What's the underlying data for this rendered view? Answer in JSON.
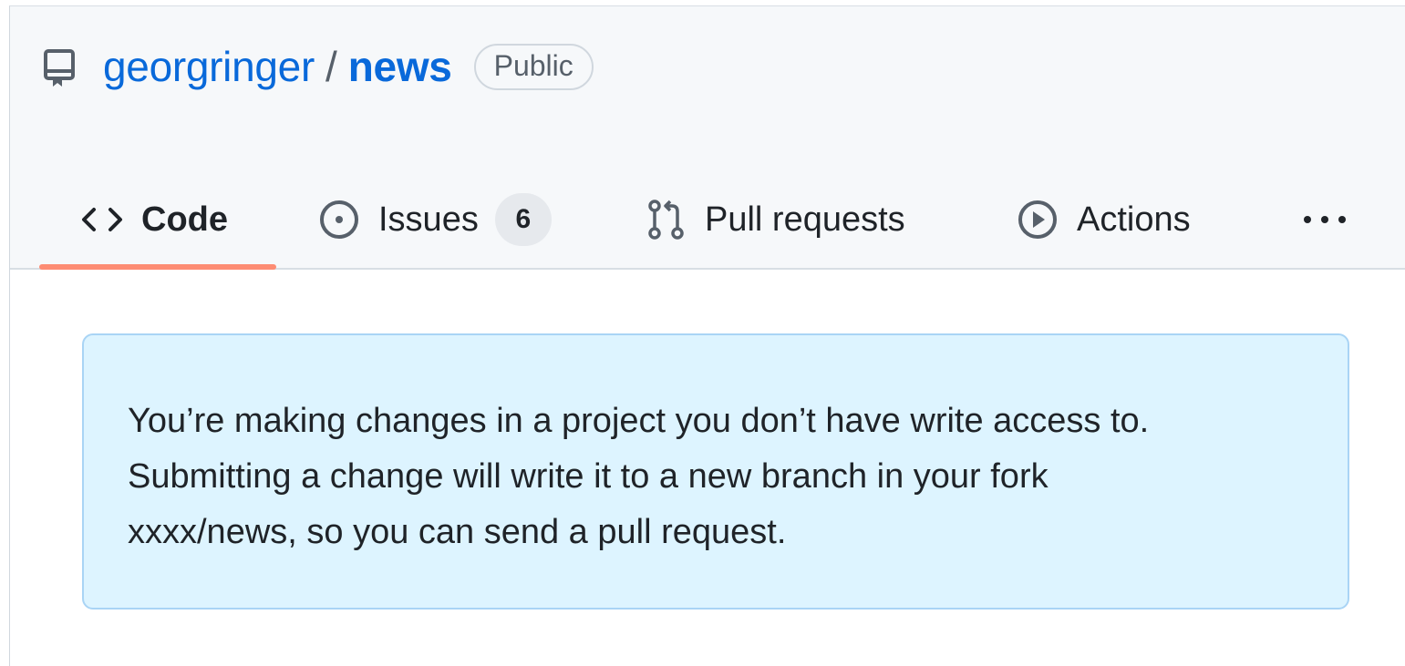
{
  "repo_header": {
    "owner": "georgringer",
    "separator": "/",
    "name": "news",
    "visibility": "Public",
    "repo_icon": "repo-icon"
  },
  "tabs": [
    {
      "label": "Code",
      "icon": "code-icon",
      "selected": true
    },
    {
      "label": "Issues",
      "icon": "issue-opened-icon",
      "counter": "6"
    },
    {
      "label": "Pull requests",
      "icon": "git-pull-request-icon"
    },
    {
      "label": "Actions",
      "icon": "play-icon"
    },
    {
      "label": "",
      "icon": "kebab-horizontal-icon"
    }
  ],
  "flash": {
    "lines": [
      "You’re making changes in a project you don’t have write access to.",
      "Submitting a change will write it to a new branch in your fork",
      "xxxx/news, so you can send a pull request."
    ]
  },
  "colors": {
    "link": "#0969da",
    "selected_tab_underline": "#fd8c73",
    "flash_background": "#ddf4ff",
    "flash_border": "#a9d4f5",
    "header_background": "#f6f8fa"
  }
}
